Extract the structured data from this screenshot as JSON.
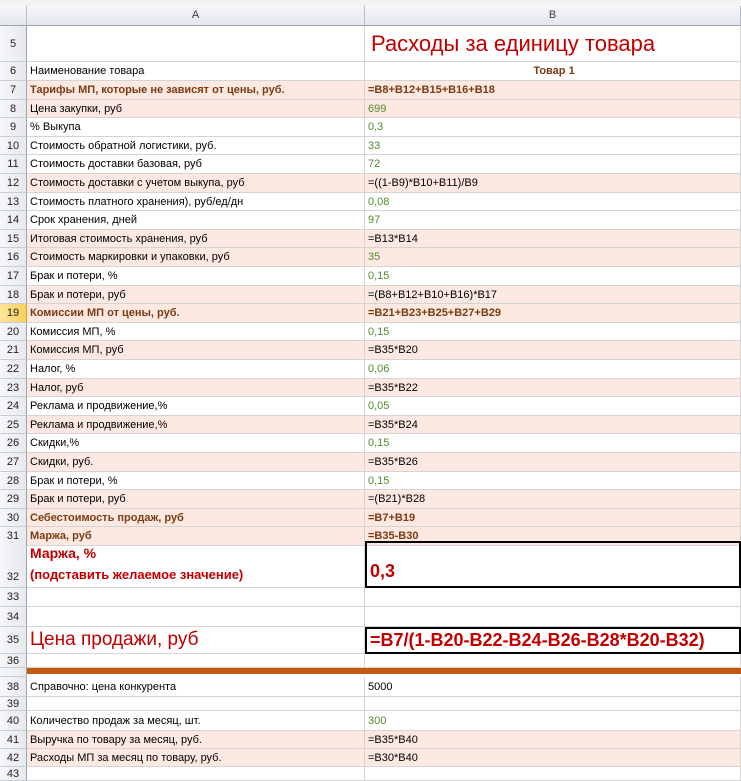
{
  "sheet": {
    "col_a": "A",
    "col_b": "B",
    "title": "Расходы за единицу товара",
    "header_label": "Наименование товара",
    "header_value": "Товар 1"
  },
  "rows": [
    {
      "n": "7",
      "a": "Тарифы МП, которые не зависят от цены, руб.",
      "b": "=B8+B12+B15+B16+B18"
    },
    {
      "n": "8",
      "a": "Цена закупки, руб",
      "b": "699"
    },
    {
      "n": "9",
      "a": "% Выкупа",
      "b": "0,3"
    },
    {
      "n": "10",
      "a": "Стоимость обратной логистики, руб.",
      "b": "33"
    },
    {
      "n": "11",
      "a": "Стоимость доставки базовая, руб",
      "b": "72"
    },
    {
      "n": "12",
      "a": "Стоимость доставки с учетом выкупа, руб",
      "b": "=((1-B9)*B10+B11)/B9"
    },
    {
      "n": "13",
      "a": "Стоимость платного хранения), руб/ед/дн",
      "b": "0,08"
    },
    {
      "n": "14",
      "a": "Срок хранения, дней",
      "b": "97"
    },
    {
      "n": "15",
      "a": "Итоговая стоимость хранения, руб",
      "b": "=B13*B14"
    },
    {
      "n": "16",
      "a": "Стоимость маркировки и упаковки, руб",
      "b": "35"
    },
    {
      "n": "17",
      "a": "Брак и потери, %",
      "b": "0,15"
    },
    {
      "n": "18",
      "a": "Брак и потери, руб",
      "b": "=(B8+B12+B10+B16)*B17"
    },
    {
      "n": "19",
      "a": "Комиссии МП от цены, руб.",
      "b": "=B21+B23+B25+B27+B29"
    },
    {
      "n": "20",
      "a": "Комиссия МП, %",
      "b": "0,15"
    },
    {
      "n": "21",
      "a": "Комиссия МП, руб",
      "b": "=B35*B20"
    },
    {
      "n": "22",
      "a": "Налог, %",
      "b": "0,06"
    },
    {
      "n": "23",
      "a": "Налог, руб",
      "b": "=B35*B22"
    },
    {
      "n": "24",
      "a": "Реклама и продвижение,%",
      "b": "0,05"
    },
    {
      "n": "25",
      "a": "Реклама и продвижение,%",
      "b": "=B35*B24"
    },
    {
      "n": "26",
      "a": "Скидки,%",
      "b": "0,15"
    },
    {
      "n": "27",
      "a": "Скидки, руб.",
      "b": "=B35*B26"
    },
    {
      "n": "28",
      "a": "Брак и потери, %",
      "b": "0,15"
    },
    {
      "n": "29",
      "a": "Брак и потери, руб",
      "b": "=(B21)*B28"
    },
    {
      "n": "30",
      "a": "Себестоимость продаж, руб",
      "b": "=B7+B19"
    },
    {
      "n": "31",
      "a": "Маржа, руб",
      "b": "=B35-B30"
    }
  ],
  "margin": {
    "n": "32",
    "label1": "Маржа, %",
    "label2": "(подставить желаемое значение)",
    "value": "0,3"
  },
  "price": {
    "n": "35",
    "label": "Цена продажи, руб",
    "formula": "=B7/(1-B20-B22-B24-B26-B28*B20-B32)"
  },
  "extra": [
    {
      "n": "38",
      "a": "Справочно: цена конкурента",
      "b": "5000"
    },
    {
      "n": "40",
      "a": "Количество продаж за месяц, шт.",
      "b": "300"
    },
    {
      "n": "41",
      "a": "Выручка по товару за месяц, руб.",
      "b": "=B35*B40"
    },
    {
      "n": "42",
      "a": "Расходы МП за месяц по товару, руб.",
      "b": "=B30*B40"
    }
  ],
  "empty_rows": [
    "33",
    "34",
    "36",
    "37",
    "39",
    "43"
  ],
  "colors": {
    "accent_red": "#c00000",
    "row_pink": "#fde9e1",
    "band_orange": "#c65911",
    "num_green": "#4f8a2c"
  }
}
